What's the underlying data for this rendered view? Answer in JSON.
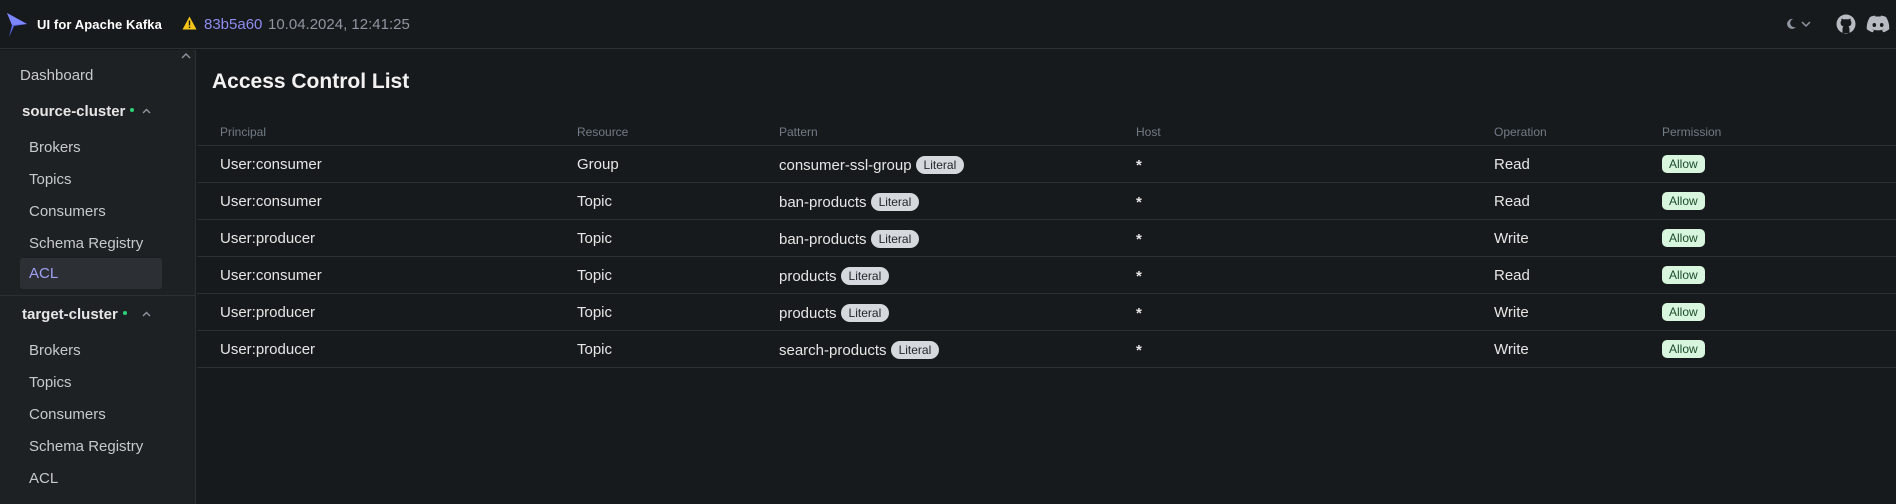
{
  "header": {
    "brand": "UI for Apache Kafka",
    "commit": "83b5a60",
    "build_date": "10.04.2024, 12:41:25"
  },
  "sidebar": {
    "dashboard": "Dashboard",
    "clusters": [
      {
        "name": "source-cluster",
        "items": [
          "Brokers",
          "Topics",
          "Consumers",
          "Schema Registry",
          "ACL"
        ],
        "active_item": "ACL"
      },
      {
        "name": "target-cluster",
        "items": [
          "Brokers",
          "Topics",
          "Consumers",
          "Schema Registry",
          "ACL"
        ]
      }
    ]
  },
  "main": {
    "title": "Access Control List",
    "columns": [
      "Principal",
      "Resource",
      "Pattern",
      "Host",
      "Operation",
      "Permission"
    ],
    "rows": [
      {
        "principal": "User:consumer",
        "resource": "Group",
        "pattern": "consumer-ssl-group",
        "pattern_type": "Literal",
        "host": "*",
        "operation": "Read",
        "permission": "Allow"
      },
      {
        "principal": "User:consumer",
        "resource": "Topic",
        "pattern": "ban-products",
        "pattern_type": "Literal",
        "host": "*",
        "operation": "Read",
        "permission": "Allow"
      },
      {
        "principal": "User:producer",
        "resource": "Topic",
        "pattern": "ban-products",
        "pattern_type": "Literal",
        "host": "*",
        "operation": "Write",
        "permission": "Allow"
      },
      {
        "principal": "User:consumer",
        "resource": "Topic",
        "pattern": "products",
        "pattern_type": "Literal",
        "host": "*",
        "operation": "Read",
        "permission": "Allow"
      },
      {
        "principal": "User:producer",
        "resource": "Topic",
        "pattern": "products",
        "pattern_type": "Literal",
        "host": "*",
        "operation": "Write",
        "permission": "Allow"
      },
      {
        "principal": "User:producer",
        "resource": "Topic",
        "pattern": "search-products",
        "pattern_type": "Literal",
        "host": "*",
        "operation": "Write",
        "permission": "Allow"
      }
    ]
  },
  "icons": {
    "logo": "kafka-ui-logo-icon",
    "warning": "warning-icon",
    "theme": "moon-icon",
    "github": "github-icon",
    "discord": "discord-icon"
  },
  "colors": {
    "accent": "#8e8cf0",
    "status_online": "#2ed47a",
    "allow_badge_bg": "#d8f5dd",
    "literal_badge_bg": "#d5d9de",
    "warning": "#f5c518"
  }
}
